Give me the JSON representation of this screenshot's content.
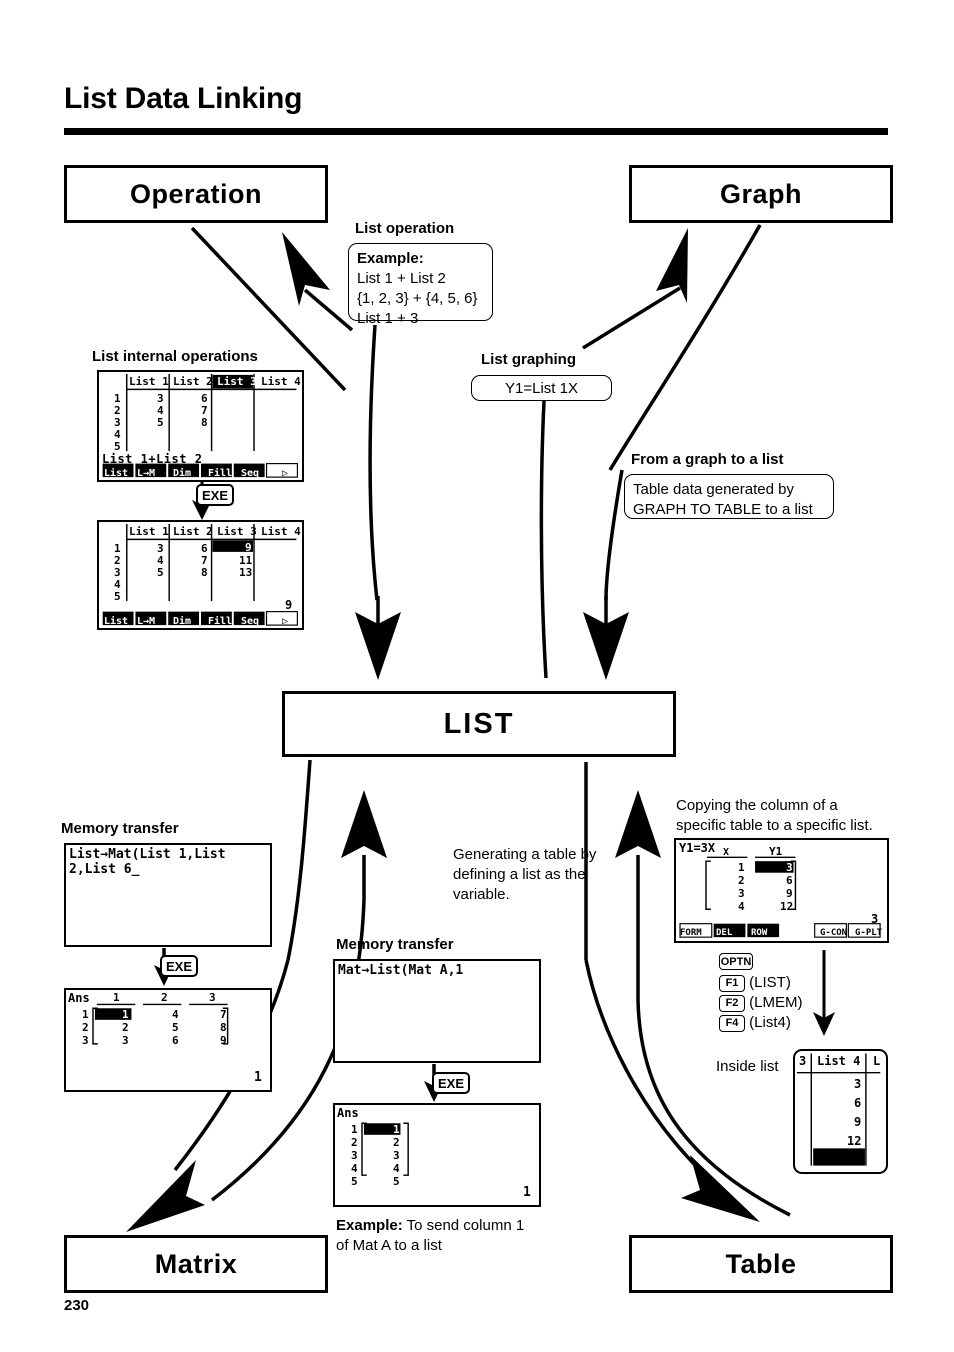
{
  "page": {
    "title": "List Data Linking",
    "number": "230"
  },
  "modules": {
    "operation": "Operation",
    "graph": "Graph",
    "list": "LIST",
    "matrix": "Matrix",
    "table": "Table"
  },
  "callouts": {
    "list_operation": {
      "heading": "List operation",
      "example_label": "Example:",
      "line1": "List 1 + List 2",
      "line2": "{1, 2, 3} + {4, 5, 6}",
      "line3": "List 1 + 3"
    },
    "list_graphing": {
      "heading": "List graphing",
      "body": "Y1=List 1X"
    },
    "graph_to_list": {
      "heading": "From a graph to a list",
      "line1": "Table data generated by",
      "line2": "GRAPH TO TABLE to a list"
    },
    "list_internal": {
      "heading": "List internal operations"
    },
    "memory_transfer_left": {
      "heading": "Memory transfer"
    },
    "memory_transfer_mid": {
      "heading": "Memory transfer",
      "example_label": "Example:",
      "example_line1": " To send column 1",
      "example_line2": "of Mat A to a list"
    },
    "generating_table": {
      "line1": "Generating a table by",
      "line2": "defining a list as the",
      "line3": "variable."
    },
    "copying_column": {
      "line1": "Copying the column of a",
      "line2": "specific table to a specific list."
    },
    "inside_list_label": "Inside list"
  },
  "keys": {
    "exe": "EXE",
    "optn": "OPTN",
    "f1": "F1",
    "f1_arg": "(LIST)",
    "f2": "F2",
    "f2_arg": "(LMEM)",
    "f4": "F4",
    "f4_arg": "(List4)"
  },
  "screens": {
    "list_editor_before": {
      "columns": [
        "List 1",
        "List 2",
        "List 3",
        "List 4"
      ],
      "selected_column_index": 2,
      "row_numbers": [
        "1",
        "2",
        "3",
        "4",
        "5"
      ],
      "cells": [
        [
          "3",
          "6",
          "",
          ""
        ],
        [
          "4",
          "7",
          "",
          ""
        ],
        [
          "5",
          "8",
          "",
          ""
        ],
        [
          "",
          "",
          "",
          ""
        ],
        [
          "",
          "",
          "",
          ""
        ]
      ],
      "entry_line": "List 1+List 2_",
      "softkeys": [
        "List",
        "L→M",
        "Dim",
        "Fill",
        "Seq",
        "▷"
      ]
    },
    "list_editor_after": {
      "columns": [
        "List 1",
        "List 2",
        "List 3",
        "List 4"
      ],
      "row_numbers": [
        "1",
        "2",
        "3",
        "4",
        "5"
      ],
      "cells": [
        [
          "3",
          "6",
          "9",
          ""
        ],
        [
          "4",
          "7",
          "11",
          ""
        ],
        [
          "5",
          "8",
          "13",
          ""
        ],
        [
          "",
          "",
          "",
          ""
        ],
        [
          "",
          "",
          "",
          ""
        ]
      ],
      "highlighted_cell": "9",
      "status_value": "9",
      "softkeys": [
        "List",
        "L→M",
        "Dim",
        "Fill",
        "Seq",
        "▷"
      ]
    },
    "list_to_mat_input": {
      "line1": "List→Mat(List 1,List",
      "line2": "2,List 6_"
    },
    "list_to_mat_ans": {
      "label": "Ans",
      "col_headers": [
        "1",
        "2",
        "3"
      ],
      "row_numbers": [
        "1",
        "2",
        "3"
      ],
      "rows": [
        [
          "1",
          "4",
          "7"
        ],
        [
          "2",
          "5",
          "8"
        ],
        [
          "3",
          "6",
          "9"
        ]
      ],
      "highlighted_cell": "1",
      "status_value": "1"
    },
    "mat_to_list_input": {
      "line1": "Mat→List(Mat A,1"
    },
    "mat_to_list_ans": {
      "label": "Ans",
      "row_numbers": [
        "1",
        "2",
        "3",
        "4",
        "5"
      ],
      "values": [
        "1",
        "2",
        "3",
        "4",
        "5"
      ],
      "highlighted_cell": "1",
      "status_value": "1"
    },
    "graph_table": {
      "formula": "Y1=3X",
      "col_headers": [
        "X",
        "Y1"
      ],
      "rows": [
        [
          "1",
          "3"
        ],
        [
          "2",
          "6"
        ],
        [
          "3",
          "9"
        ],
        [
          "4",
          "12"
        ]
      ],
      "highlighted_cell": "3",
      "status_value": "3",
      "softkeys_left": [
        "FORM",
        "DEL",
        "ROW"
      ],
      "softkeys_right": [
        "G-CON",
        "G-PLT"
      ]
    },
    "inside_list": {
      "left_col_header": "3",
      "column_header": "List 4",
      "right_col_header": "L",
      "values": [
        "3",
        "6",
        "9",
        "12"
      ]
    }
  },
  "colors": {
    "ink": "#000000",
    "paper": "#ffffff"
  }
}
